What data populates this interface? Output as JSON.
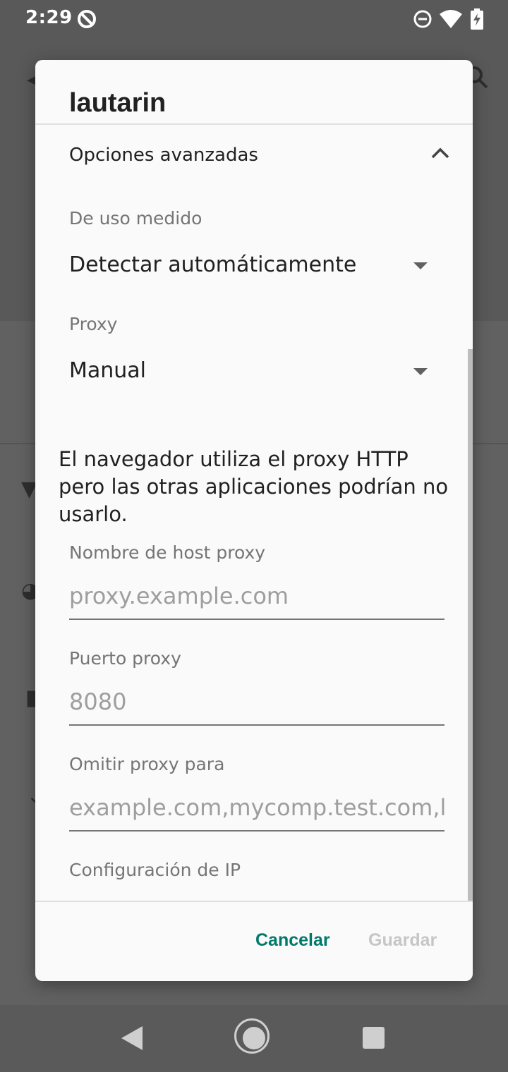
{
  "status_bar": {
    "time": "2:29",
    "icons": [
      "data-saver-icon",
      "do-not-disturb-icon",
      "wifi-icon",
      "battery-charging-icon"
    ]
  },
  "dialog": {
    "title": "lautarin",
    "advanced_options_label": "Opciones avanzadas",
    "metered": {
      "label": "De uso medido",
      "value": "Detectar automáticamente"
    },
    "proxy": {
      "label": "Proxy",
      "value": "Manual"
    },
    "proxy_note": "El navegador utiliza el proxy HTTP pero las otras aplicaciones podrían no usarlo.",
    "proxy_hostname": {
      "label": "Nombre de host proxy",
      "placeholder": "proxy.example.com",
      "value": ""
    },
    "proxy_port": {
      "label": "Puerto proxy",
      "placeholder": "8080",
      "value": ""
    },
    "bypass_proxy": {
      "label": "Omitir proxy para",
      "placeholder": "example.com,mycomp.test.com,localhost",
      "value": ""
    },
    "ip_settings_label": "Configuración de IP",
    "cancel_label": "Cancelar",
    "save_label": "Guardar"
  },
  "colors": {
    "accent": "#00796b",
    "disabled": "#c6c6c6",
    "scrim": "#5f5f5f"
  }
}
